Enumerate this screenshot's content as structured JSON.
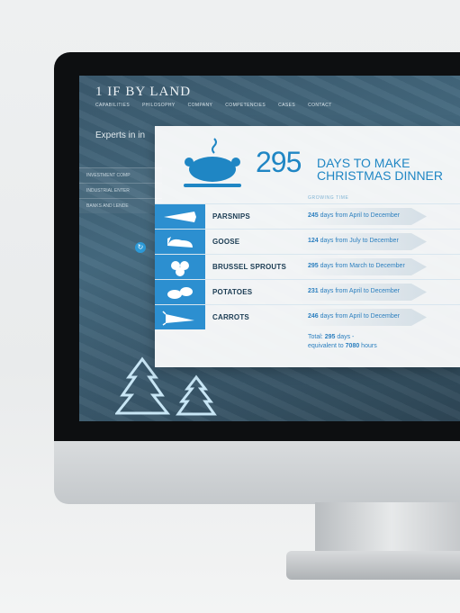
{
  "site": {
    "logo": "1 IF BY LAND",
    "nav": [
      "CAPABILITIES",
      "PHILOSOPHY",
      "COMPANY",
      "COMPETENCIES",
      "CASES",
      "CONTACT"
    ],
    "hero_text": "Experts in in",
    "side_items": [
      "INVESTMENT COMP",
      "INDUSTRIAL ENTER",
      "BANKS AND LENDE"
    ]
  },
  "card": {
    "title_number": "295",
    "title_line1": "DAYS TO MAKE",
    "title_line2": "CHRISTMAS DINNER",
    "growing_label": "GROWING TIME",
    "rows": [
      {
        "icon": "parsnip-icon",
        "name": "PARSNIPS",
        "days": "245",
        "text": " days from April to December"
      },
      {
        "icon": "goose-icon",
        "name": "GOOSE",
        "days": "124",
        "text": " days from July to December"
      },
      {
        "icon": "sprouts-icon",
        "name": "BRUSSEL SPROUTS",
        "days": "295",
        "text": " days from March to December"
      },
      {
        "icon": "potato-icon",
        "name": "POTATOES",
        "days": "231",
        "text": " days from April to December"
      },
      {
        "icon": "carrot-icon",
        "name": "CARROTS",
        "days": "246",
        "text": " days from April to December"
      }
    ],
    "total_prefix": "Total: ",
    "total_days": "295",
    "total_days_suffix": " days -",
    "total_equiv_prefix": "equivalent to ",
    "total_hours": "7080",
    "total_hours_suffix": " hours"
  },
  "colors": {
    "accent": "#1f86c4",
    "icon_bg": "#2c8fd0"
  }
}
